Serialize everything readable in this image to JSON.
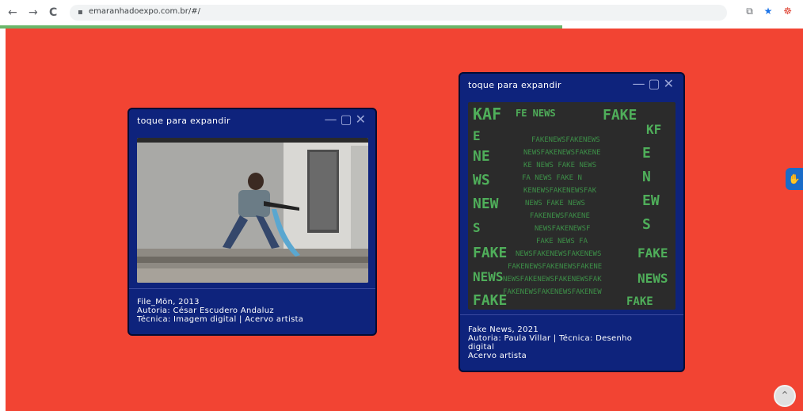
{
  "browser": {
    "url": "emaranhadoexpo.com.br/#/",
    "back_icon": "←",
    "forward_icon": "→",
    "reload_icon": "C",
    "lock_icon": "🔒",
    "ext_icon1": "⧉",
    "star_icon": "★",
    "ext_icon2": "☸",
    "loading_progress_percent": 70
  },
  "colors": {
    "page_bg": "#f24433",
    "card_bg": "#0e237c",
    "progress": "#6ab66a"
  },
  "cards": [
    {
      "title": "toque para expandir",
      "controls": "—▢✕",
      "caption_line1": "File_Mön, 2013",
      "caption_line2": "Autoria: César Escudero Andaluz",
      "caption_line3": "Técnica: Imagem digital | Acervo artista"
    },
    {
      "title": "toque para expandir",
      "controls": "—▢✕",
      "caption_line1": "Fake News, 2021",
      "caption_line2": "Autoria: Paula Villar | Técnica: Desenho",
      "caption_line3": "digital",
      "caption_line4": "Acervo artista"
    }
  ],
  "accessibility_button": "✋",
  "scroll_top_icon": "⌃"
}
